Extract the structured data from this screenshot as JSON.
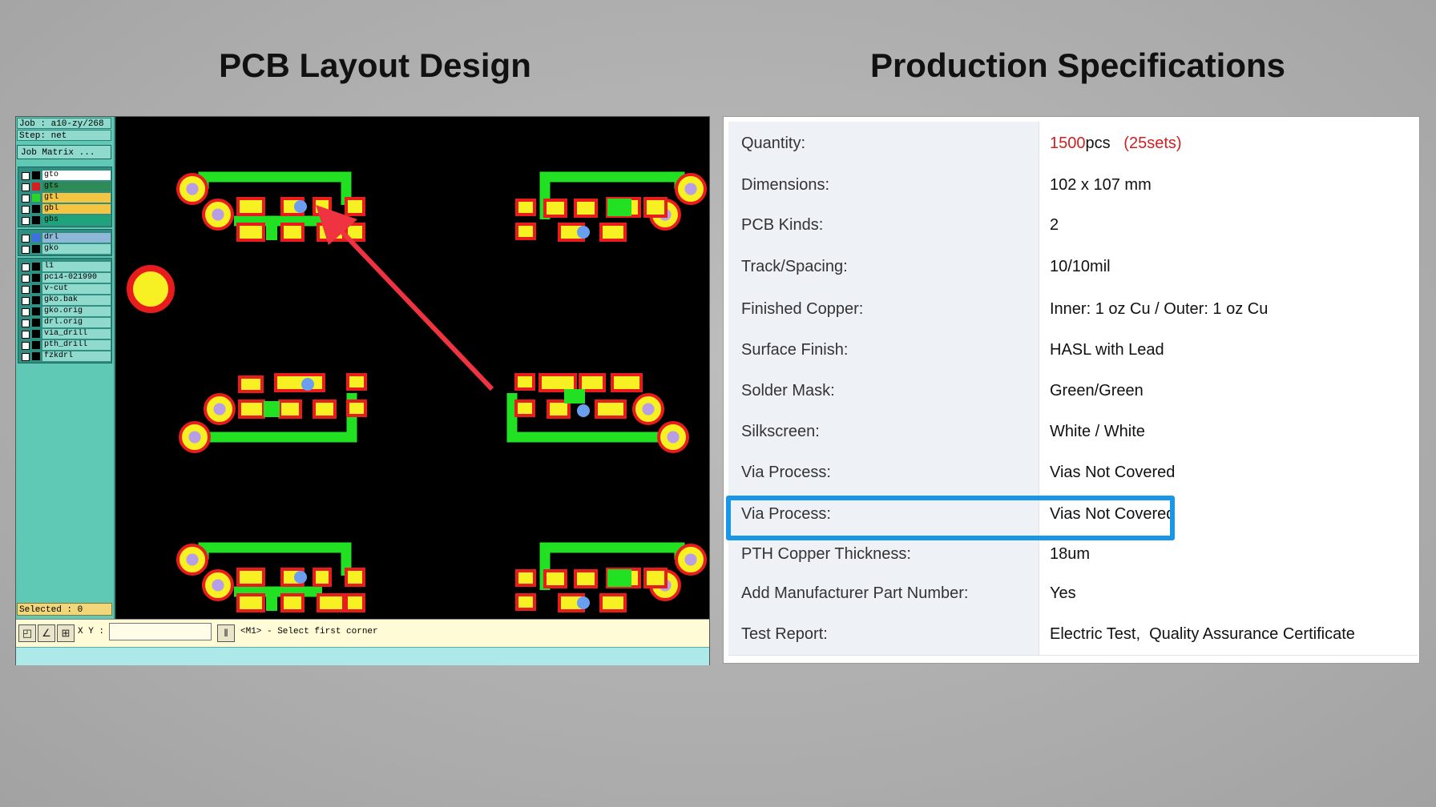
{
  "headings": {
    "left": "PCB Layout Design",
    "right": "Production Specifications"
  },
  "cad": {
    "job": "Job : a10-zy/268",
    "step": "Step: net",
    "job_matrix_button": "Job Matrix ...",
    "layers_group1": [
      {
        "name": "gto",
        "color": "#ffffff",
        "swatch": "#000000"
      },
      {
        "name": "gts",
        "color": "#2e8b57",
        "swatch": "#d41f1f"
      },
      {
        "name": "gtl",
        "color": "#f4c542",
        "swatch": "#2ad52a"
      },
      {
        "name": "gbl",
        "color": "#f4c542",
        "swatch": "#000000"
      },
      {
        "name": "gbs",
        "color": "#1fa37a",
        "swatch": "#000000"
      }
    ],
    "layers_group2": [
      {
        "name": "drl",
        "color": "#8fb8d8",
        "swatch": "#3f6fe0"
      },
      {
        "name": "gko",
        "color": "#8fd9cd",
        "swatch": "#000000"
      }
    ],
    "layers_group3": [
      {
        "name": "l1",
        "color": "#8fd9cd"
      },
      {
        "name": "pci4-021990",
        "color": "#8fd9cd"
      },
      {
        "name": "v-cut",
        "color": "#8fd9cd"
      },
      {
        "name": "gko.bak",
        "color": "#8fd9cd"
      },
      {
        "name": "gko.orig",
        "color": "#8fd9cd"
      },
      {
        "name": "drl.orig",
        "color": "#8fd9cd"
      },
      {
        "name": "via_drill",
        "color": "#8fd9cd"
      },
      {
        "name": "pth_drill",
        "color": "#8fd9cd"
      },
      {
        "name": "fzkdrl",
        "color": "#8fd9cd"
      }
    ],
    "selected": "Selected : 0",
    "xy_label": "X Y :",
    "xy_value": "",
    "status_message": "<M1> - Select first corner",
    "tool_icons": [
      "select-icon",
      "measure-icon",
      "grid-icon"
    ],
    "colors": {
      "pad_fill": "#f7f023",
      "pad_outline": "#e81c1c",
      "trace": "#22e022",
      "drill": "#b79ee6",
      "via": "#6a9ff0",
      "arrow": "#ef3340",
      "background": "#000000"
    }
  },
  "specs": {
    "rows": [
      {
        "label": "Quantity:",
        "value_parts": [
          {
            "text": "1500",
            "red": true
          },
          {
            "text": "pcs   ",
            "red": false
          },
          {
            "text": "(25sets)",
            "red": true
          }
        ]
      },
      {
        "label": "Dimensions:",
        "value": "102 x 107 mm"
      },
      {
        "label": "PCB Kinds:",
        "value": "2"
      },
      {
        "label": "Track/Spacing:",
        "value": "10/10mil"
      },
      {
        "label": "Finished Copper:",
        "value": "Inner: 1 oz Cu / Outer: 1 oz Cu"
      },
      {
        "label": "Surface Finish:",
        "value": "HASL with Lead"
      },
      {
        "label": "Solder Mask:",
        "value": "Green/Green"
      },
      {
        "label": "Silkscreen:",
        "value": "White / White"
      },
      {
        "label": "Via Process:",
        "value": "Vias Not Covered"
      },
      {
        "label": "Via Process:",
        "value": "Vias Not Covered",
        "highlighted": true
      },
      {
        "label": "PTH Copper Thickness:",
        "value": "18um"
      },
      {
        "label": "Add Manufacturer Part Number:",
        "value": "Yes"
      },
      {
        "label": "Test Report:",
        "value": "Electric Test,  Quality Assurance Certificate"
      }
    ],
    "highlight_color": "#1a96e6"
  }
}
